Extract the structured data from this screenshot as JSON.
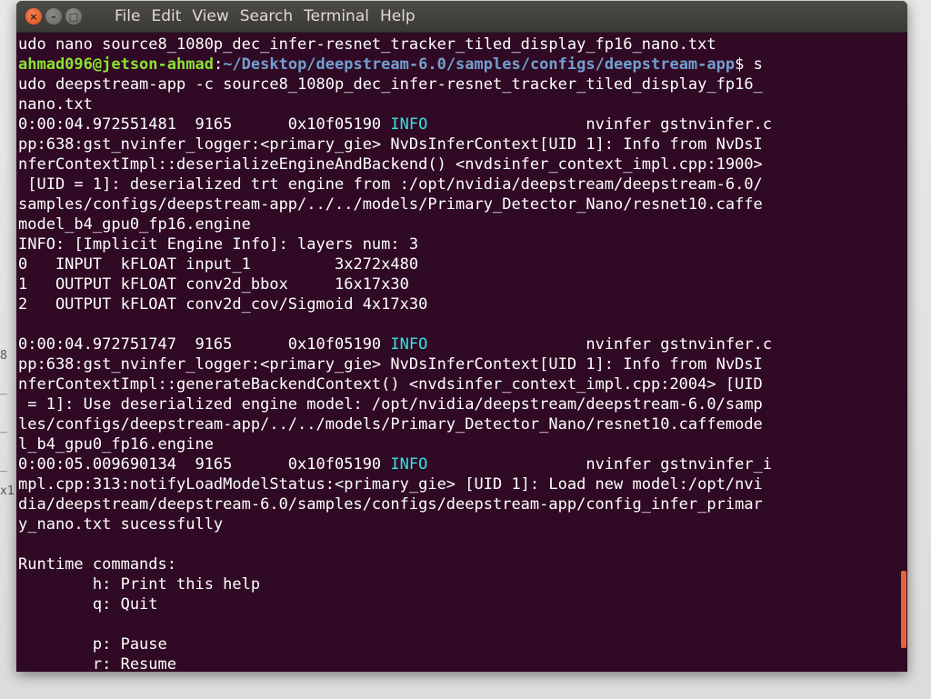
{
  "window": {
    "menus": [
      "File",
      "Edit",
      "View",
      "Search",
      "Terminal",
      "Help"
    ],
    "controls": {
      "close": "×",
      "minimize": "–",
      "maximize": "□"
    }
  },
  "terminal": {
    "lines": [
      [
        {
          "t": "udo nano source8_1080p_dec_infer-resnet_tracker_tiled_display_fp16_nano.txt"
        }
      ],
      [
        {
          "t": "ahmad096@jetson-ahmad",
          "c": "user"
        },
        {
          "t": ":",
          "c": "plain"
        },
        {
          "t": "~/Desktop/deepstream-6.0/samples/configs/deepstream-app",
          "c": "path"
        },
        {
          "t": "$ s"
        }
      ],
      [
        {
          "t": "udo deepstream-app -c source8_1080p_dec_infer-resnet_tracker_tiled_display_fp16_"
        }
      ],
      [
        {
          "t": "nano.txt"
        }
      ],
      [
        {
          "t": "0:00:04.972551481  9165      0x10f05190 "
        },
        {
          "t": "INFO",
          "c": "info"
        },
        {
          "t": "                 nvinfer gstnvinfer.c"
        }
      ],
      [
        {
          "t": "pp:638:gst_nvinfer_logger:<primary_gie> NvDsInferContext[UID 1]: Info from NvDsI"
        }
      ],
      [
        {
          "t": "nferContextImpl::deserializeEngineAndBackend() <nvdsinfer_context_impl.cpp:1900>"
        }
      ],
      [
        {
          "t": " [UID = 1]: deserialized trt engine from :/opt/nvidia/deepstream/deepstream-6.0/"
        }
      ],
      [
        {
          "t": "samples/configs/deepstream-app/../../models/Primary_Detector_Nano/resnet10.caffe"
        }
      ],
      [
        {
          "t": "model_b4_gpu0_fp16.engine"
        }
      ],
      [
        {
          "t": "INFO: [Implicit Engine Info]: layers num: 3"
        }
      ],
      [
        {
          "t": "0   INPUT  kFLOAT input_1         3x272x480"
        }
      ],
      [
        {
          "t": "1   OUTPUT kFLOAT conv2d_bbox     16x17x30"
        }
      ],
      [
        {
          "t": "2   OUTPUT kFLOAT conv2d_cov/Sigmoid 4x17x30"
        }
      ],
      [
        {
          "t": ""
        }
      ],
      [
        {
          "t": "0:00:04.972751747  9165      0x10f05190 "
        },
        {
          "t": "INFO",
          "c": "info"
        },
        {
          "t": "                 nvinfer gstnvinfer.c"
        }
      ],
      [
        {
          "t": "pp:638:gst_nvinfer_logger:<primary_gie> NvDsInferContext[UID 1]: Info from NvDsI"
        }
      ],
      [
        {
          "t": "nferContextImpl::generateBackendContext() <nvdsinfer_context_impl.cpp:2004> [UID"
        }
      ],
      [
        {
          "t": " = 1]: Use deserialized engine model: /opt/nvidia/deepstream/deepstream-6.0/samp"
        }
      ],
      [
        {
          "t": "les/configs/deepstream-app/../../models/Primary_Detector_Nano/resnet10.caffemode"
        }
      ],
      [
        {
          "t": "l_b4_gpu0_fp16.engine"
        }
      ],
      [
        {
          "t": "0:00:05.009690134  9165      0x10f05190 "
        },
        {
          "t": "INFO",
          "c": "info"
        },
        {
          "t": "                 nvinfer gstnvinfer_i"
        }
      ],
      [
        {
          "t": "mpl.cpp:313:notifyLoadModelStatus:<primary_gie> [UID 1]: Load new model:/opt/nvi"
        }
      ],
      [
        {
          "t": "dia/deepstream/deepstream-6.0/samples/configs/deepstream-app/config_infer_primar"
        }
      ],
      [
        {
          "t": "y_nano.txt sucessfully"
        }
      ],
      [
        {
          "t": ""
        }
      ],
      [
        {
          "t": "Runtime commands:"
        }
      ],
      [
        {
          "t": "        h: Print this help"
        }
      ],
      [
        {
          "t": "        q: Quit"
        }
      ],
      [
        {
          "t": ""
        }
      ],
      [
        {
          "t": "        p: Pause"
        }
      ],
      [
        {
          "t": "        r: Resume"
        }
      ]
    ]
  },
  "background": {
    "fragments": [
      "8",
      "_",
      "_",
      "_",
      "x1"
    ]
  },
  "colors": {
    "terminal_bg": "#300a24",
    "prompt_user": "#8ae234",
    "prompt_path": "#729fcf",
    "info": "#34e2e2",
    "close_button": "#df4b16",
    "scroll_thumb": "#e2643a"
  }
}
